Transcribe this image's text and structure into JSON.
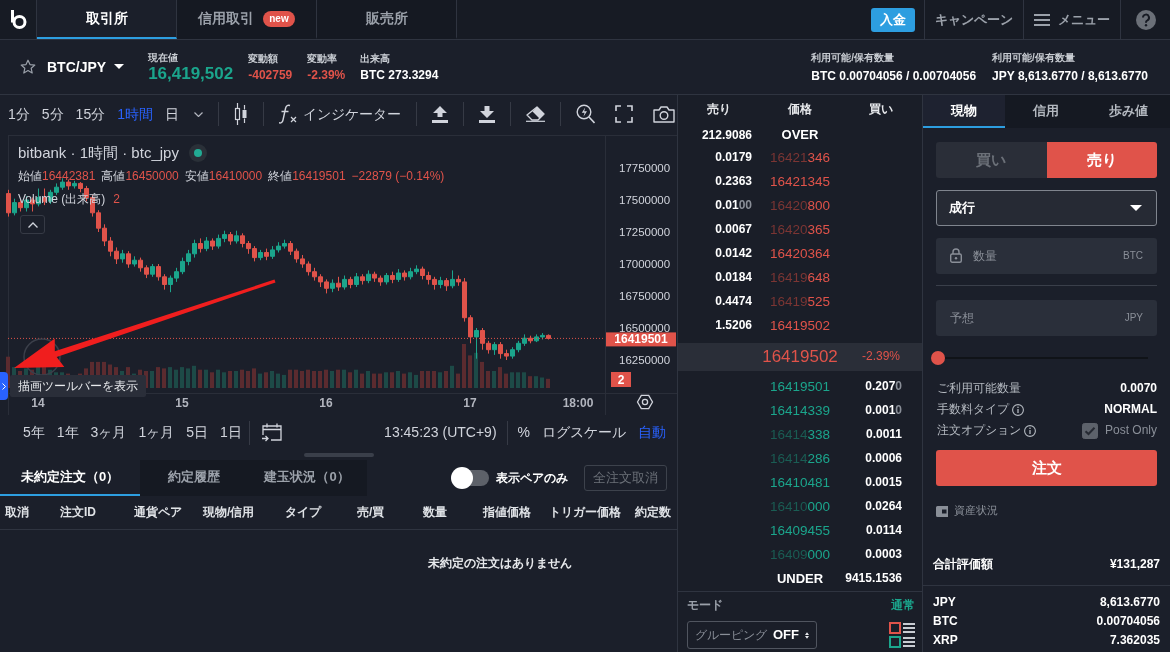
{
  "nav": {
    "tabs": [
      {
        "label": "取引所",
        "selected": true
      },
      {
        "label": "信用取引",
        "selected": false,
        "badge": "new"
      },
      {
        "label": "販売所",
        "selected": false
      }
    ],
    "deposit": "入金",
    "links": [
      {
        "kind": "text",
        "label": "キャンペーン"
      },
      {
        "kind": "menu",
        "label": "メニュー"
      }
    ]
  },
  "ticker": {
    "favorite": false,
    "pair": "BTC/JPY",
    "stats": [
      {
        "kind": "main",
        "label": "現在値",
        "value": "16,419,502",
        "color": "#1ba58c"
      },
      {
        "kind": "stat",
        "label": "変動額",
        "value": "-402759",
        "color": "#e0534a"
      },
      {
        "kind": "stat",
        "label": "変動率",
        "value": "-2.39%",
        "color": "#e0534a"
      },
      {
        "kind": "stat",
        "label": "出来高",
        "value": "BTC 273.3294",
        "color": "#ffffff"
      }
    ],
    "balances": [
      {
        "label": "利用可能/保有数量",
        "value": "BTC 0.00704056 / 0.00704056"
      },
      {
        "label": "利用可能/保有数量",
        "value": "JPY 8,613.6770 / 8,613.6770"
      }
    ]
  },
  "chart": {
    "intervals": [
      {
        "label": "1分",
        "selected": false
      },
      {
        "label": "5分",
        "selected": false
      },
      {
        "label": "15分",
        "selected": false
      },
      {
        "label": "1時間",
        "selected": true
      },
      {
        "label": "日",
        "selected": false
      }
    ],
    "indicators_button": "インジケーター",
    "legend": {
      "title": "bitbank · 1時間 · btc_jpy",
      "live": true,
      "ohlc": [
        {
          "label": "始値",
          "value": "16442381"
        },
        {
          "label": "高値",
          "value": "16450000"
        },
        {
          "label": "安値",
          "value": "16410000"
        },
        {
          "label": "終値",
          "value": "16419501"
        }
      ],
      "change": "−22879 (−0.14%)",
      "volume_label": "Volume (出来高)",
      "volume_value": "2"
    },
    "price_axis": [
      "17750000",
      "17500000",
      "17250000",
      "17000000",
      "16750000",
      "16500000",
      "16250000"
    ],
    "time_axis": [
      "14",
      "15",
      "16",
      "17",
      "18:00"
    ],
    "annotation": {
      "kind": "arrow"
    },
    "price_tag": "16419501",
    "volume_tag": "2",
    "tooltip": "描画ツールバーを表示",
    "ranges": [
      "5年",
      "1年",
      "3ヶ月",
      "1ヶ月",
      "5日",
      "1日"
    ],
    "clock": "13:45:23 (UTC+9)",
    "scale_options": [
      {
        "label": "%",
        "on": false
      },
      {
        "label": "ログスケール",
        "on": false
      },
      {
        "label": "自動",
        "on": true
      }
    ]
  },
  "orders": {
    "tabs": [
      {
        "label": "未約定注文（0）",
        "selected": true
      },
      {
        "label": "約定履歴",
        "selected": false
      },
      {
        "label": "建玉状況（0）",
        "selected": false
      }
    ],
    "pair_filter": {
      "label": "表示ペアのみ",
      "on": false
    },
    "cancel_all": {
      "label": "全注文取消",
      "disabled": true
    },
    "columns": [
      "取消",
      "注文ID",
      "通貨ペア",
      "現物/信用",
      "タイプ",
      "売/買",
      "数量",
      "指値価格",
      "トリガー価格",
      "約定数"
    ],
    "empty_message": "未約定の注文はありません"
  },
  "order_book": {
    "columns": [
      "売り",
      "価格",
      "買い"
    ],
    "over": {
      "amount": "212.9086",
      "label": "OVER"
    },
    "asks": [
      {
        "amount": "0.0179",
        "price": "16421346",
        "highlighted": false
      },
      {
        "amount": "0.2363",
        "price": "16421345",
        "highlighted": true
      },
      {
        "amount": "0.0100",
        "price": "16420800",
        "highlighted": false
      },
      {
        "amount": "0.0067",
        "price": "16420365",
        "highlighted": false
      },
      {
        "amount": "0.0142",
        "price": "16420364",
        "highlighted": true
      },
      {
        "amount": "0.0184",
        "price": "16419648",
        "highlighted": false
      },
      {
        "amount": "0.4474",
        "price": "16419525",
        "highlighted": false
      },
      {
        "amount": "1.5206",
        "price": "16419502",
        "highlighted": true
      }
    ],
    "last": {
      "price": "16419502",
      "change": "-2.39%"
    },
    "bids": [
      {
        "price": "16419501",
        "amount": "0.2070",
        "highlighted": true
      },
      {
        "price": "16414339",
        "amount": "0.0010",
        "highlighted": true
      },
      {
        "price": "16414338",
        "amount": "0.0011",
        "highlighted": false
      },
      {
        "price": "16414286",
        "amount": "0.0006",
        "highlighted": false
      },
      {
        "price": "16410481",
        "amount": "0.0015",
        "highlighted": true
      },
      {
        "price": "16410000",
        "amount": "0.0264",
        "highlighted": false
      },
      {
        "price": "16409455",
        "amount": "0.0114",
        "highlighted": true
      },
      {
        "price": "16409000",
        "amount": "0.0003",
        "highlighted": false
      }
    ],
    "under": {
      "label": "UNDER",
      "amount": "9415.1536"
    },
    "mode": {
      "label": "モード",
      "value": "通常"
    },
    "grouping": {
      "label": "グルーピング",
      "value": "OFF"
    }
  },
  "order_form": {
    "tabs": [
      {
        "label": "現物",
        "selected": true
      },
      {
        "label": "信用",
        "selected": false
      },
      {
        "label": "歩み値",
        "selected": false
      }
    ],
    "sides": [
      {
        "kind": "buy",
        "label": "買い",
        "selected": false
      },
      {
        "kind": "sell",
        "label": "売り",
        "selected": true
      }
    ],
    "order_type": "成行",
    "fields": [
      {
        "kind": "locked",
        "placeholder": "数量",
        "unit": "BTC"
      },
      {
        "kind": "plain",
        "placeholder": "予想",
        "unit": "JPY"
      }
    ],
    "slider": {
      "level": 0
    },
    "info": [
      {
        "label": "ご利用可能数量",
        "help": false,
        "value": "0.0070"
      },
      {
        "label": "手数料タイプ",
        "help": true,
        "value": "NORMAL"
      },
      {
        "label": "注文オプション",
        "help": true,
        "option": {
          "label": "Post Only",
          "checked": true,
          "disabled": true
        }
      }
    ],
    "submit": "注文",
    "assets_link": "資産状況",
    "total": {
      "label": "合計評価額",
      "value": "¥131,287"
    },
    "holdings": [
      {
        "currency": "JPY",
        "amount": "8,613.6770"
      },
      {
        "currency": "BTC",
        "amount": "0.00704056"
      },
      {
        "currency": "XRP",
        "amount": "7.362035"
      }
    ]
  }
}
